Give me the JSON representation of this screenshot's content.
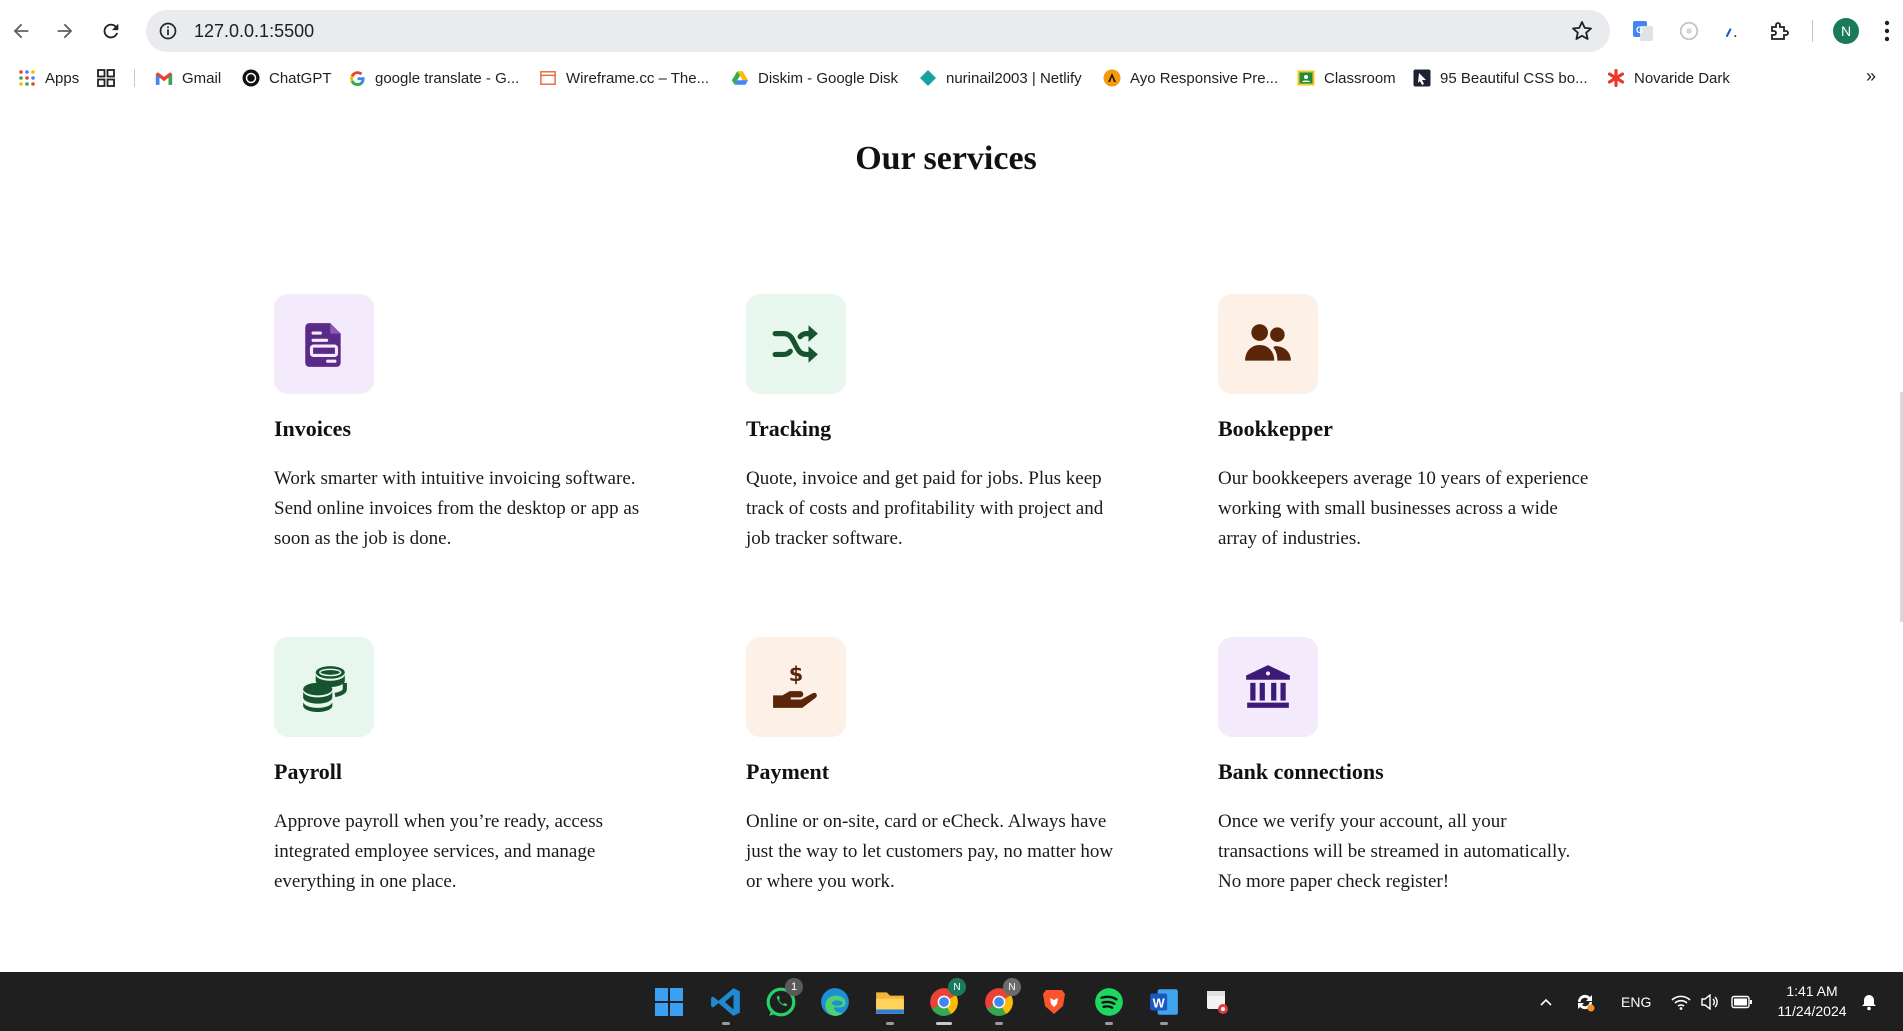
{
  "browser": {
    "url": "127.0.0.1:5500",
    "profile_initial": "N",
    "bookmarks": [
      {
        "label": "Apps",
        "icon": "apps-grid-icon"
      },
      {
        "label": "",
        "icon": "tab-groups-icon"
      },
      {
        "label": "Gmail",
        "icon": "gmail-icon"
      },
      {
        "label": "ChatGPT",
        "icon": "chatgpt-icon"
      },
      {
        "label": "google translate - G...",
        "icon": "google-icon"
      },
      {
        "label": "Wireframe.cc – The...",
        "icon": "wireframe-icon"
      },
      {
        "label": "Diskim - Google Disk",
        "icon": "google-drive-icon"
      },
      {
        "label": "nurinail2003 | Netlify",
        "icon": "netlify-icon"
      },
      {
        "label": "Ayo Responsive Pre...",
        "icon": "ayo-icon"
      },
      {
        "label": "Classroom",
        "icon": "classroom-icon"
      },
      {
        "label": "95 Beautiful CSS bo...",
        "icon": "css-bookmark-icon"
      },
      {
        "label": "Novaride Dark",
        "icon": "asterisk-icon"
      }
    ],
    "bookmarks_more": "»"
  },
  "page": {
    "title": "Our services",
    "services": [
      {
        "name": "Invoices",
        "description": "Work smarter with intuitive invoicing software. Send online invoices from the desktop or app as soon as the job is done.",
        "icon": "invoice-icon",
        "icon_color": "#5b2a86",
        "bg_color": "#f3ebfb"
      },
      {
        "name": "Tracking",
        "description": "Quote, invoice and get paid for jobs. Plus keep track of costs and profitability with project and job tracker software.",
        "icon": "shuffle-icon",
        "icon_color": "#17532f",
        "bg_color": "#e8f7ee"
      },
      {
        "name": "Bookkepper",
        "description": "Our bookkeepers average 10 years of experience working with small businesses across a wide array of industries.",
        "icon": "users-icon",
        "icon_color": "#5a2508",
        "bg_color": "#fdf0e7"
      },
      {
        "name": "Payroll",
        "description": "Approve payroll when you’re ready, access integrated employee services, and manage everything in one place.",
        "icon": "coins-icon",
        "icon_color": "#17532f",
        "bg_color": "#e8f7ee"
      },
      {
        "name": "Payment",
        "description": "Online or on-site, card or eCheck. Always have just the way to let customers pay, no matter how or where you work.",
        "icon": "hand-dollar-icon",
        "icon_color": "#5a2508",
        "bg_color": "#fdf0e7"
      },
      {
        "name": "Bank connections",
        "description": "Once we verify your account, all your transactions will be streamed in automatically. No more paper check register!",
        "icon": "bank-icon",
        "icon_color": "#3d1a78",
        "bg_color": "#f3ebfb"
      }
    ]
  },
  "taskbar": {
    "whatsapp_badge": "1",
    "chrome_badge": "N",
    "chrome2_badge": "N",
    "language": "ENG",
    "time": "1:41 AM",
    "date": "11/24/2024"
  }
}
